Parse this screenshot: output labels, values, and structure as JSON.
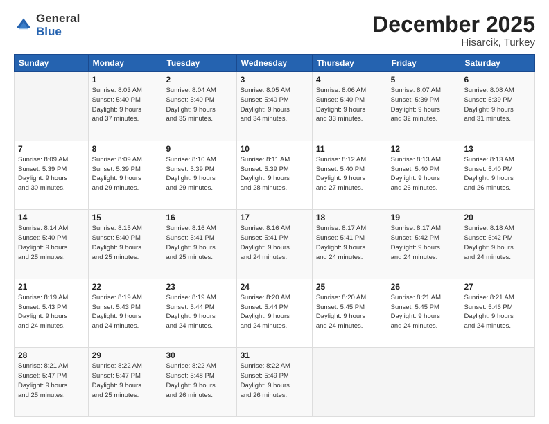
{
  "logo": {
    "general": "General",
    "blue": "Blue"
  },
  "header": {
    "month": "December 2025",
    "location": "Hisarcik, Turkey"
  },
  "days_of_week": [
    "Sunday",
    "Monday",
    "Tuesday",
    "Wednesday",
    "Thursday",
    "Friday",
    "Saturday"
  ],
  "weeks": [
    [
      {
        "day": "",
        "info": ""
      },
      {
        "day": "1",
        "info": "Sunrise: 8:03 AM\nSunset: 5:40 PM\nDaylight: 9 hours\nand 37 minutes."
      },
      {
        "day": "2",
        "info": "Sunrise: 8:04 AM\nSunset: 5:40 PM\nDaylight: 9 hours\nand 35 minutes."
      },
      {
        "day": "3",
        "info": "Sunrise: 8:05 AM\nSunset: 5:40 PM\nDaylight: 9 hours\nand 34 minutes."
      },
      {
        "day": "4",
        "info": "Sunrise: 8:06 AM\nSunset: 5:40 PM\nDaylight: 9 hours\nand 33 minutes."
      },
      {
        "day": "5",
        "info": "Sunrise: 8:07 AM\nSunset: 5:39 PM\nDaylight: 9 hours\nand 32 minutes."
      },
      {
        "day": "6",
        "info": "Sunrise: 8:08 AM\nSunset: 5:39 PM\nDaylight: 9 hours\nand 31 minutes."
      }
    ],
    [
      {
        "day": "7",
        "info": "Sunrise: 8:09 AM\nSunset: 5:39 PM\nDaylight: 9 hours\nand 30 minutes."
      },
      {
        "day": "8",
        "info": "Sunrise: 8:09 AM\nSunset: 5:39 PM\nDaylight: 9 hours\nand 29 minutes."
      },
      {
        "day": "9",
        "info": "Sunrise: 8:10 AM\nSunset: 5:39 PM\nDaylight: 9 hours\nand 29 minutes."
      },
      {
        "day": "10",
        "info": "Sunrise: 8:11 AM\nSunset: 5:39 PM\nDaylight: 9 hours\nand 28 minutes."
      },
      {
        "day": "11",
        "info": "Sunrise: 8:12 AM\nSunset: 5:40 PM\nDaylight: 9 hours\nand 27 minutes."
      },
      {
        "day": "12",
        "info": "Sunrise: 8:13 AM\nSunset: 5:40 PM\nDaylight: 9 hours\nand 26 minutes."
      },
      {
        "day": "13",
        "info": "Sunrise: 8:13 AM\nSunset: 5:40 PM\nDaylight: 9 hours\nand 26 minutes."
      }
    ],
    [
      {
        "day": "14",
        "info": "Sunrise: 8:14 AM\nSunset: 5:40 PM\nDaylight: 9 hours\nand 25 minutes."
      },
      {
        "day": "15",
        "info": "Sunrise: 8:15 AM\nSunset: 5:40 PM\nDaylight: 9 hours\nand 25 minutes."
      },
      {
        "day": "16",
        "info": "Sunrise: 8:16 AM\nSunset: 5:41 PM\nDaylight: 9 hours\nand 25 minutes."
      },
      {
        "day": "17",
        "info": "Sunrise: 8:16 AM\nSunset: 5:41 PM\nDaylight: 9 hours\nand 24 minutes."
      },
      {
        "day": "18",
        "info": "Sunrise: 8:17 AM\nSunset: 5:41 PM\nDaylight: 9 hours\nand 24 minutes."
      },
      {
        "day": "19",
        "info": "Sunrise: 8:17 AM\nSunset: 5:42 PM\nDaylight: 9 hours\nand 24 minutes."
      },
      {
        "day": "20",
        "info": "Sunrise: 8:18 AM\nSunset: 5:42 PM\nDaylight: 9 hours\nand 24 minutes."
      }
    ],
    [
      {
        "day": "21",
        "info": "Sunrise: 8:19 AM\nSunset: 5:43 PM\nDaylight: 9 hours\nand 24 minutes."
      },
      {
        "day": "22",
        "info": "Sunrise: 8:19 AM\nSunset: 5:43 PM\nDaylight: 9 hours\nand 24 minutes."
      },
      {
        "day": "23",
        "info": "Sunrise: 8:19 AM\nSunset: 5:44 PM\nDaylight: 9 hours\nand 24 minutes."
      },
      {
        "day": "24",
        "info": "Sunrise: 8:20 AM\nSunset: 5:44 PM\nDaylight: 9 hours\nand 24 minutes."
      },
      {
        "day": "25",
        "info": "Sunrise: 8:20 AM\nSunset: 5:45 PM\nDaylight: 9 hours\nand 24 minutes."
      },
      {
        "day": "26",
        "info": "Sunrise: 8:21 AM\nSunset: 5:45 PM\nDaylight: 9 hours\nand 24 minutes."
      },
      {
        "day": "27",
        "info": "Sunrise: 8:21 AM\nSunset: 5:46 PM\nDaylight: 9 hours\nand 24 minutes."
      }
    ],
    [
      {
        "day": "28",
        "info": "Sunrise: 8:21 AM\nSunset: 5:47 PM\nDaylight: 9 hours\nand 25 minutes."
      },
      {
        "day": "29",
        "info": "Sunrise: 8:22 AM\nSunset: 5:47 PM\nDaylight: 9 hours\nand 25 minutes."
      },
      {
        "day": "30",
        "info": "Sunrise: 8:22 AM\nSunset: 5:48 PM\nDaylight: 9 hours\nand 26 minutes."
      },
      {
        "day": "31",
        "info": "Sunrise: 8:22 AM\nSunset: 5:49 PM\nDaylight: 9 hours\nand 26 minutes."
      },
      {
        "day": "",
        "info": ""
      },
      {
        "day": "",
        "info": ""
      },
      {
        "day": "",
        "info": ""
      }
    ]
  ]
}
